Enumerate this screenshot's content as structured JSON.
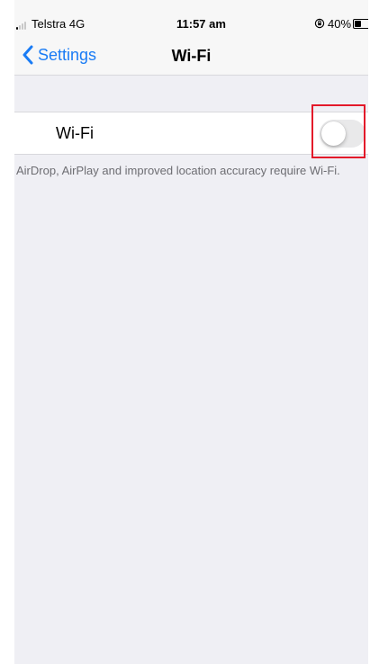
{
  "status_bar": {
    "carrier": "Telstra  4G",
    "time": "11:57 am",
    "battery_percent": "40%",
    "battery_level": 0.4,
    "icons": [
      "signal-icon",
      "orientation-lock-icon",
      "battery-icon"
    ]
  },
  "nav": {
    "back_label": "Settings",
    "title": "Wi-Fi"
  },
  "wifi_row": {
    "label": "Wi-Fi",
    "toggle_on": false
  },
  "footer_note": "AirDrop, AirPlay and improved location accuracy require Wi-Fi.",
  "colors": {
    "accent": "#1a7cf5",
    "highlight_box": "#e3192a",
    "background": "#efeff4"
  }
}
